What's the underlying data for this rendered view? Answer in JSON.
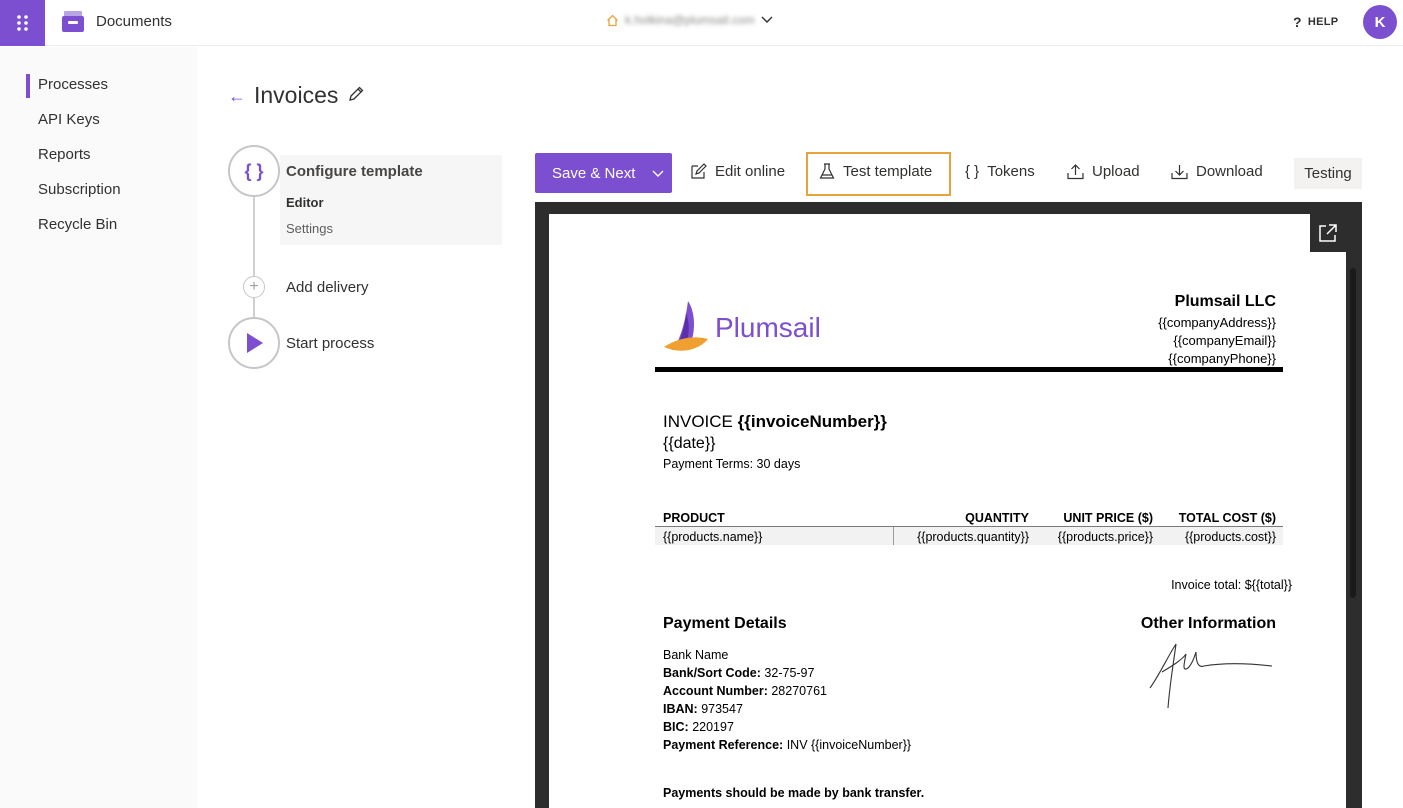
{
  "header": {
    "app_title": "Documents",
    "account_email": "k.holkina@plumsail.com",
    "help_label": "HELP",
    "avatar_initial": "K"
  },
  "sidebar": {
    "items": [
      {
        "label": "Processes",
        "active": true
      },
      {
        "label": "API Keys",
        "active": false
      },
      {
        "label": "Reports",
        "active": false
      },
      {
        "label": "Subscription",
        "active": false
      },
      {
        "label": "Recycle Bin",
        "active": false
      }
    ]
  },
  "page": {
    "title": "Invoices"
  },
  "steps": {
    "configure": {
      "label": "Configure template",
      "sub_editor": "Editor",
      "sub_settings": "Settings"
    },
    "delivery": {
      "label": "Add delivery"
    },
    "start": {
      "label": "Start process"
    }
  },
  "toolbar": {
    "save_next": "Save & Next",
    "edit_online": "Edit online",
    "test_template": "Test template",
    "tokens": "Tokens",
    "upload": "Upload",
    "download": "Download",
    "testing": "Testing"
  },
  "document": {
    "logo_text": "Plumsail",
    "company_name": "Plumsail LLC",
    "company_address": "{{companyAddress}}",
    "company_email": "{{companyEmail}}",
    "company_phone": "{{companyPhone}}",
    "invoice_label": "INVOICE",
    "invoice_number": "{{invoiceNumber}}",
    "date": "{{date}}",
    "payment_terms": "Payment Terms: 30 days",
    "table": {
      "headers": [
        "PRODUCT",
        "QUANTITY",
        "UNIT PRICE ($)",
        "TOTAL COST ($)"
      ],
      "row": [
        "{{products.name}}",
        "{{products.quantity}}",
        "{{products.price}}",
        "{{products.cost}}"
      ]
    },
    "invoice_total": "Invoice total: ${{total}}",
    "payment_details_title": "Payment Details",
    "other_info_title": "Other Information",
    "bank_name": "Bank Name",
    "sort_code_label": "Bank/Sort Code:",
    "sort_code": "32-75-97",
    "account_number_label": "Account Number:",
    "account_number": "28270761",
    "iban_label": "IBAN:",
    "iban": "973547",
    "bic_label": "BIC:",
    "bic": "220197",
    "payment_ref_label": "Payment Reference:",
    "payment_ref": "INV {{invoiceNumber}}",
    "footer_note": "Payments should be made by bank transfer."
  },
  "colors": {
    "accent": "#7b4fd0",
    "highlight": "#e8a33c",
    "viewer_bg": "#2d2d2d"
  }
}
